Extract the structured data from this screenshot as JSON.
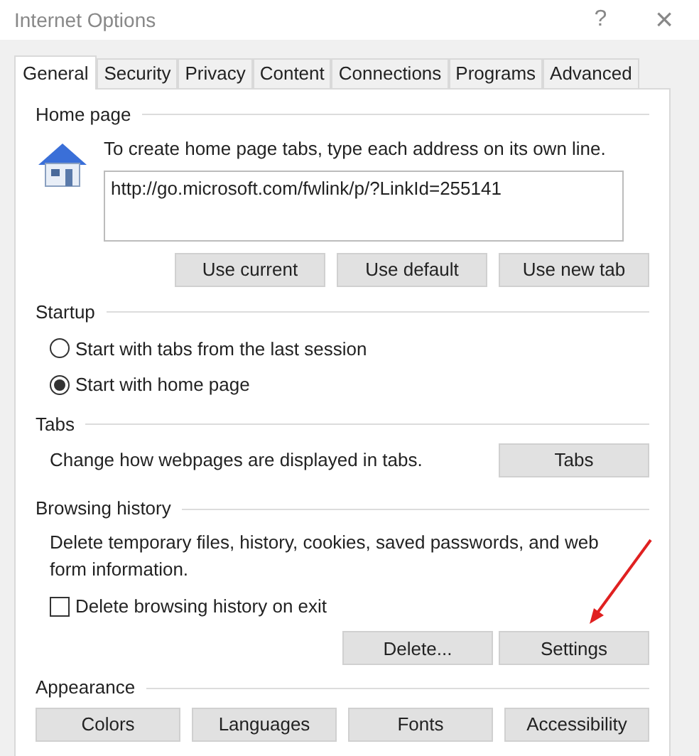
{
  "window": {
    "title": "Internet Options",
    "help": "?",
    "close": "×"
  },
  "tabs": [
    {
      "label": "General",
      "selected": true
    },
    {
      "label": "Security",
      "selected": false
    },
    {
      "label": "Privacy",
      "selected": false
    },
    {
      "label": "Content",
      "selected": false
    },
    {
      "label": "Connections",
      "selected": false
    },
    {
      "label": "Programs",
      "selected": false
    },
    {
      "label": "Advanced",
      "selected": false
    }
  ],
  "home_page": {
    "heading": "Home page",
    "description": "To create home page tabs, type each address on its own line.",
    "value": "http://go.microsoft.com/fwlink/p/?LinkId=255141",
    "buttons": [
      "Use current",
      "Use default",
      "Use new tab"
    ]
  },
  "startup": {
    "heading": "Startup",
    "options": [
      {
        "label": "Start with tabs from the last session",
        "selected": false
      },
      {
        "label": "Start with home page",
        "selected": true
      }
    ]
  },
  "tabs_section": {
    "heading": "Tabs",
    "description": "Change how webpages are displayed in tabs.",
    "button": "Tabs"
  },
  "browsing_history": {
    "heading": "Browsing history",
    "description": "Delete temporary files, history, cookies, saved passwords, and web form information.",
    "checkbox": {
      "label": "Delete browsing history on exit",
      "checked": false
    },
    "buttons": [
      "Delete...",
      "Settings"
    ]
  },
  "appearance": {
    "heading": "Appearance",
    "buttons": [
      "Colors",
      "Languages",
      "Fonts",
      "Accessibility"
    ]
  }
}
